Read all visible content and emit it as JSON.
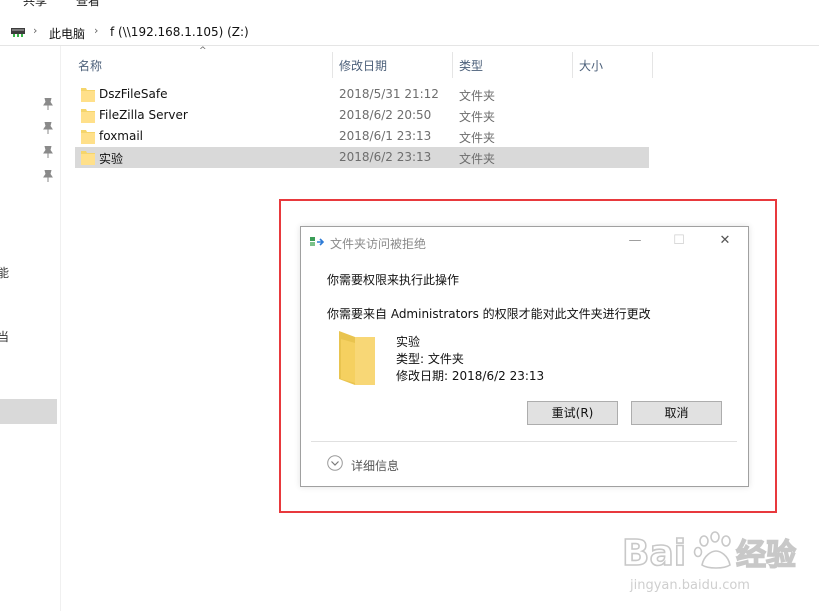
{
  "ribbon": {
    "tabs": [
      "共享",
      "查看"
    ]
  },
  "address": {
    "segments": [
      "此电脑",
      "f (\\\\192.168.1.105) (Z:)"
    ]
  },
  "nav": {
    "partial_labels": [
      "能",
      "当"
    ]
  },
  "columns": {
    "name": "名称",
    "modified": "修改日期",
    "type": "类型",
    "size": "大小"
  },
  "files": [
    {
      "name": "DszFileSafe",
      "date": "2018/5/31 21:12",
      "type": "文件夹"
    },
    {
      "name": "FileZilla Server",
      "date": "2018/6/2 20:50",
      "type": "文件夹"
    },
    {
      "name": "foxmail",
      "date": "2018/6/1 23:13",
      "type": "文件夹"
    },
    {
      "name": "实验",
      "date": "2018/6/2 23:13",
      "type": "文件夹"
    }
  ],
  "dialog": {
    "title": "文件夹访问被拒绝",
    "heading": "你需要权限来执行此操作",
    "message": "你需要来自 Administrators 的权限才能对此文件夹进行更改",
    "item_name": "实验",
    "item_type": "类型: 文件夹",
    "item_date": "修改日期: 2018/6/2 23:13",
    "retry_label": "重试(R)",
    "cancel_label": "取消",
    "details_label": "详细信息",
    "controls": {
      "minimize": "—",
      "maximize": "☐",
      "close": "✕"
    }
  },
  "colors": {
    "selection": "#d9d9d9",
    "annotation": "#e8393d",
    "folder": "#f5d56b"
  }
}
